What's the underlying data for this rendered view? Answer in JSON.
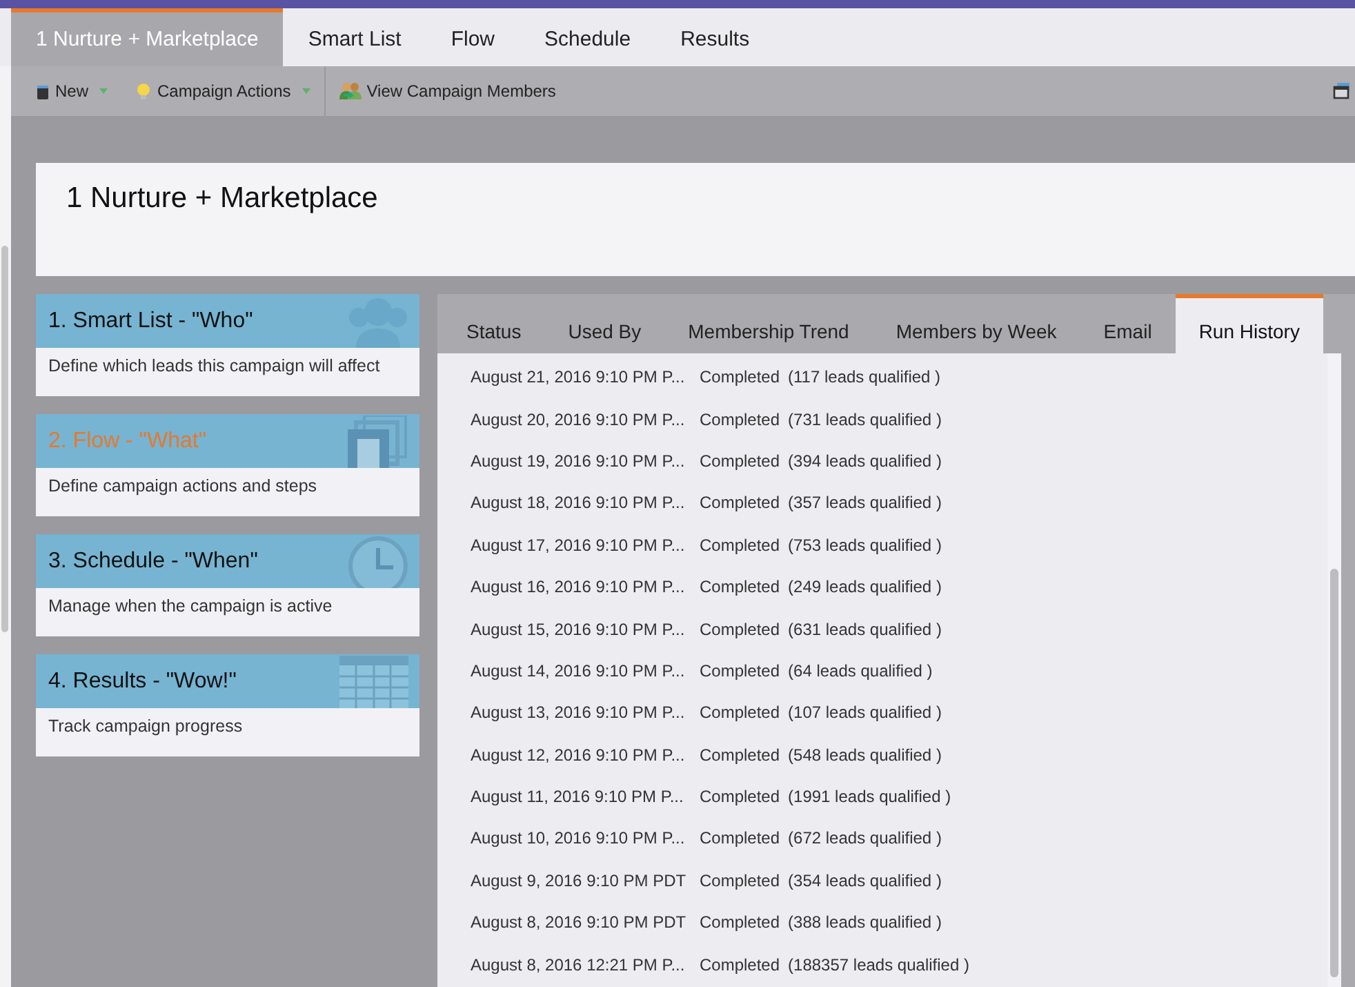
{
  "tabs": [
    {
      "label": "1 Nurture + Marketplace",
      "selected": true
    },
    {
      "label": "Smart List",
      "selected": false
    },
    {
      "label": "Flow",
      "selected": false
    },
    {
      "label": "Schedule",
      "selected": false
    },
    {
      "label": "Results",
      "selected": false
    }
  ],
  "toolbar": [
    {
      "label": "New",
      "kind": "new",
      "dropdown": true
    },
    {
      "label": "Campaign Actions",
      "kind": "actions",
      "dropdown": true
    },
    {
      "label": "View Campaign Members",
      "kind": "members",
      "dropdown": false
    }
  ],
  "header": {
    "title": "1 Nurture + Marketplace"
  },
  "steps": [
    {
      "title": "1. Smart List - \"Who\"",
      "description": "Define which leads this campaign will affect",
      "kind": "people",
      "selected": false
    },
    {
      "title": "2. Flow - \"What\"",
      "description": "Define campaign actions and steps",
      "kind": "stack",
      "selected": true
    },
    {
      "title": "3. Schedule - \"When\"",
      "description": "Manage when the campaign is active",
      "kind": "clock",
      "selected": false
    },
    {
      "title": "4. Results - \"Wow!\"",
      "description": "Track campaign progress",
      "kind": "grid",
      "selected": false
    }
  ],
  "panel_tabs": [
    {
      "label": "Status",
      "selected": false
    },
    {
      "label": "Used By",
      "selected": false
    },
    {
      "label": "Membership Trend",
      "selected": false
    },
    {
      "label": "Members by Week",
      "selected": false
    },
    {
      "label": "Email",
      "selected": false
    },
    {
      "label": "Run History",
      "selected": true
    }
  ],
  "run_history": [
    {
      "date": "August 21, 2016 9:10 PM P...",
      "status": "Completed",
      "result": "(117 leads qualified )"
    },
    {
      "date": "August 20, 2016 9:10 PM P...",
      "status": "Completed",
      "result": "(731 leads qualified )"
    },
    {
      "date": "August 19, 2016 9:10 PM P...",
      "status": "Completed",
      "result": "(394 leads qualified )"
    },
    {
      "date": "August 18, 2016 9:10 PM P...",
      "status": "Completed",
      "result": "(357 leads qualified )"
    },
    {
      "date": "August 17, 2016 9:10 PM P...",
      "status": "Completed",
      "result": "(753 leads qualified )"
    },
    {
      "date": "August 16, 2016 9:10 PM P...",
      "status": "Completed",
      "result": "(249 leads qualified )"
    },
    {
      "date": "August 15, 2016 9:10 PM P...",
      "status": "Completed",
      "result": "(631 leads qualified )"
    },
    {
      "date": "August 14, 2016 9:10 PM P...",
      "status": "Completed",
      "result": "(64 leads qualified )"
    },
    {
      "date": "August 13, 2016 9:10 PM P...",
      "status": "Completed",
      "result": "(107 leads qualified )"
    },
    {
      "date": "August 12, 2016 9:10 PM P...",
      "status": "Completed",
      "result": "(548 leads qualified )"
    },
    {
      "date": "August 11, 2016 9:10 PM P...",
      "status": "Completed",
      "result": "(1991 leads qualified )"
    },
    {
      "date": "August 10, 2016 9:10 PM P...",
      "status": "Completed",
      "result": "(672 leads qualified )"
    },
    {
      "date": "August 9, 2016 9:10 PM PDT",
      "status": "Completed",
      "result": "(354 leads qualified )"
    },
    {
      "date": "August 8, 2016 9:10 PM PDT",
      "status": "Completed",
      "result": "(388 leads qualified )"
    },
    {
      "date": "August 8, 2016 12:21 PM P...",
      "status": "Completed",
      "result": "(188357 leads qualified )"
    }
  ]
}
